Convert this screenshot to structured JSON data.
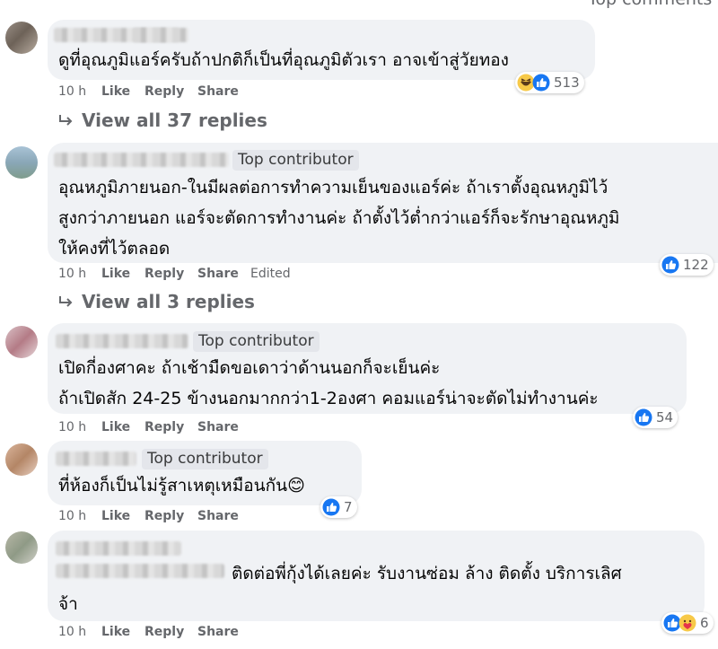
{
  "top_label": "Top comments",
  "comments": [
    {
      "text_lines": [
        "ดูที่อุณภูมิแอร์ครับถ้าปกติก็เป็นที่อุณภูมิตัวเรา อาจเข้าสู่วัยทอง"
      ],
      "badge": "",
      "time": "10 h",
      "like": "Like",
      "reply": "Reply",
      "share": "Share",
      "edited": "",
      "reaction_count": "513",
      "reaction_icons": [
        "haha-icon",
        "like-icon"
      ],
      "view_replies": "View all 37 replies"
    },
    {
      "text_lines": [
        "อุณหภูมิภายนอก-ในมีผลต่อการทำความเย็นของแอร์ค่ะ ถ้าเราตั้งอุณหภูมิไว้",
        "สูงกว่าภายนอก แอร์จะตัดการทำงานค่ะ ถ้าตั้งไว้ต่ำกว่าแอร์ก็จะรักษาอุณหภูมิ",
        "ให้คงที่ไว้ตลอด"
      ],
      "badge": "Top contributor",
      "time": "10 h",
      "like": "Like",
      "reply": "Reply",
      "share": "Share",
      "edited": "Edited",
      "reaction_count": "122",
      "reaction_icons": [
        "like-icon"
      ],
      "view_replies": "View all 3 replies"
    },
    {
      "text_lines": [
        "เปิดกี่องศาคะ ถ้าเช้ามืดขอเดาว่าด้านนอกก็จะเย็นค่ะ",
        "ถ้าเปิดสัก 24-25 ข้างนอกมากกว่า1-2องศา คอมแอร์น่าจะตัดไม่ทำงานค่ะ"
      ],
      "badge": "Top contributor",
      "time": "10 h",
      "like": "Like",
      "reply": "Reply",
      "share": "Share",
      "edited": "",
      "reaction_count": "54",
      "reaction_icons": [
        "like-icon"
      ],
      "view_replies": ""
    },
    {
      "text_lines": [
        "ที่ห้องก็เป็นไม่รู้สาเหตุเหมือนกัน😊"
      ],
      "badge": "Top contributor",
      "time": "10 h",
      "like": "Like",
      "reply": "Reply",
      "share": "Share",
      "edited": "",
      "reaction_count": "7",
      "reaction_icons": [
        "like-icon"
      ],
      "view_replies": ""
    },
    {
      "text_lines": [
        "ติดต่อพี่กุ้งได้เลยค่ะ รับงานซ่อม ล้าง ติดตั้ง บริการเลิศ",
        "จ้า"
      ],
      "badge": "",
      "time": "10 h",
      "like": "Like",
      "reply": "Reply",
      "share": "Share",
      "edited": "",
      "reaction_count": "6",
      "reaction_icons": [
        "like-icon",
        "care-icon"
      ],
      "view_replies": ""
    }
  ],
  "colors": {
    "bubble": "#f0f2f5",
    "secondary_text": "#65676b",
    "like_blue": "#1877f2",
    "haha_yellow": "#f7c948"
  }
}
